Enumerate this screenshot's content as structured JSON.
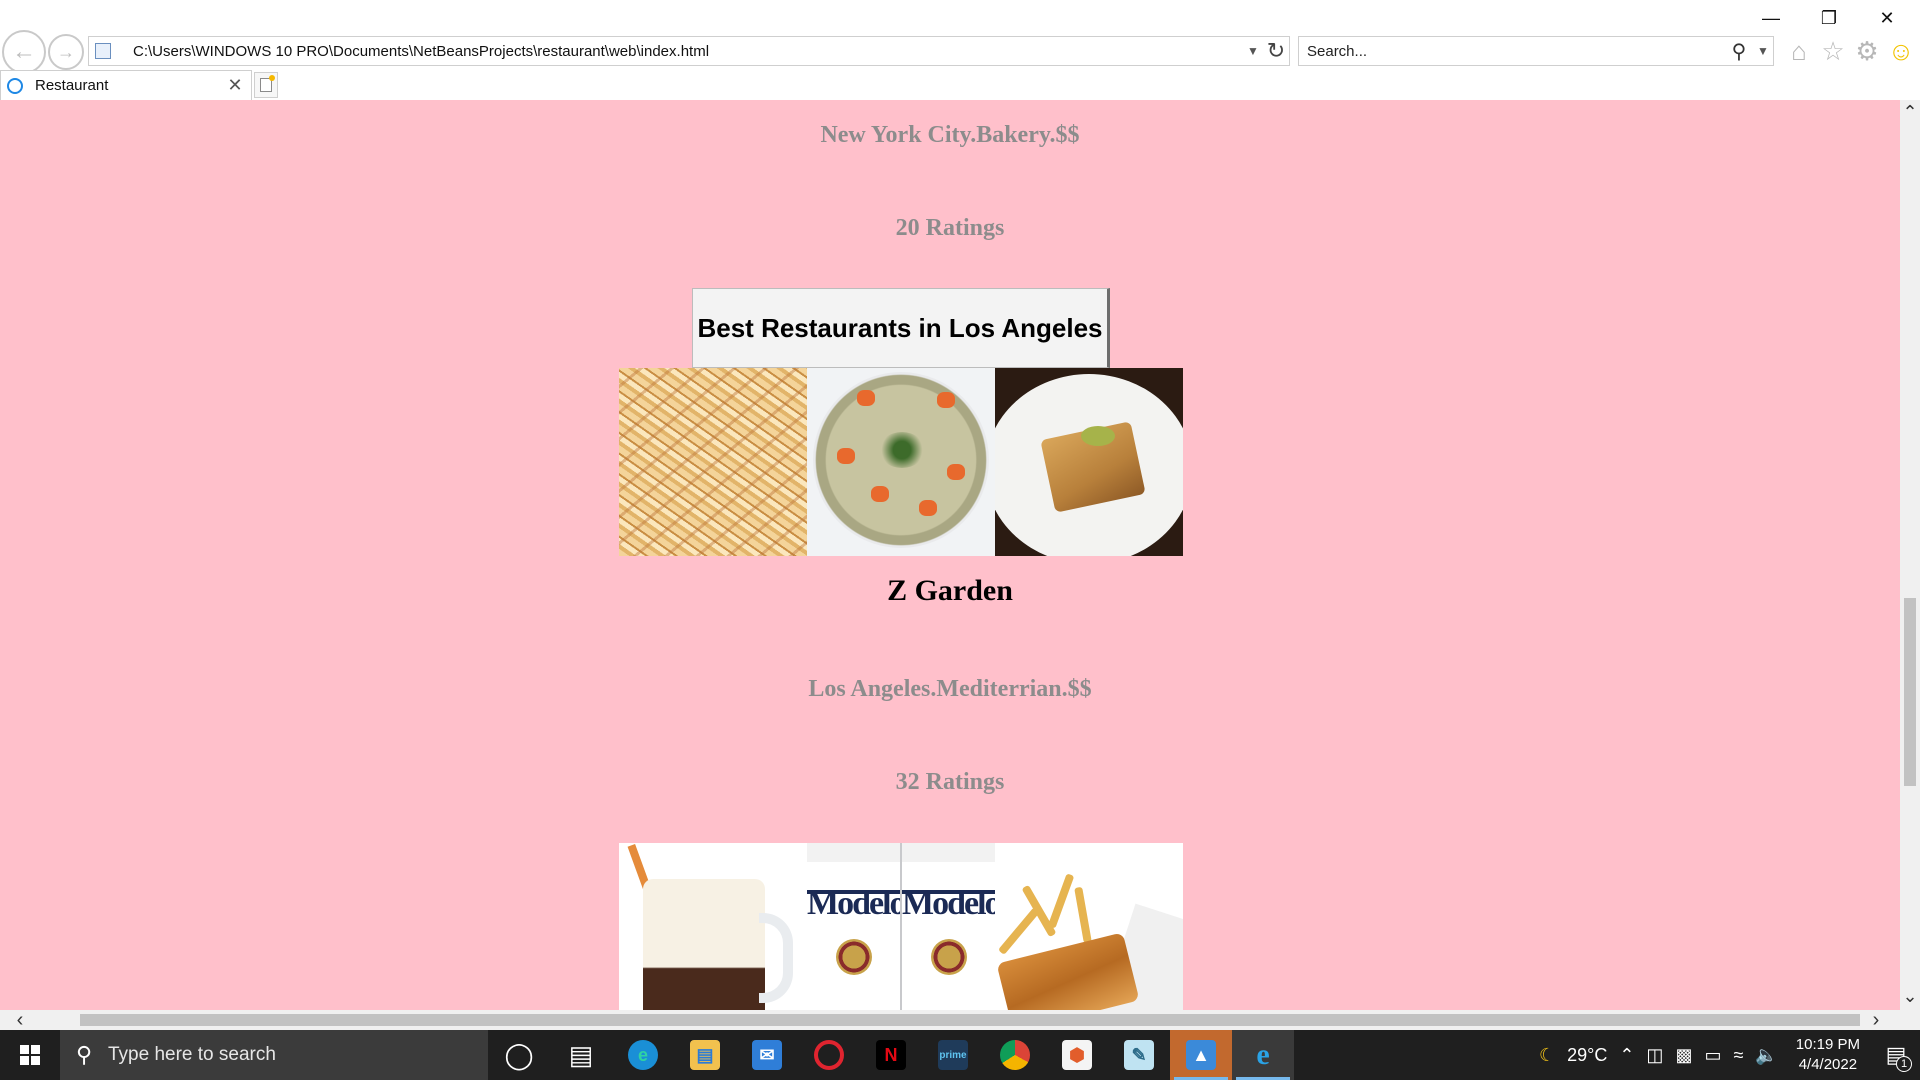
{
  "browser": {
    "address": "C:\\Users\\WINDOWS 10 PRO\\Documents\\NetBeansProjects\\restaurant\\web\\index.html",
    "search_placeholder": "Search...",
    "tab_title": "Restaurant"
  },
  "page": {
    "restaurant1": {
      "info": "New York City.Bakery.$$",
      "ratings": "20 Ratings"
    },
    "section_button": "Best Restaurants in Los Angeles",
    "restaurant2": {
      "name": "Z Garden",
      "info": "Los Angeles.Mediterrian.$$",
      "ratings": "32 Ratings"
    },
    "can_text": "Modelo"
  },
  "taskbar": {
    "search_placeholder": "Type here to search",
    "temperature": "29°C",
    "time": "10:19 PM",
    "date": "4/4/2022",
    "notifications": "1"
  },
  "colors": {
    "page_background": "#ffc0cb",
    "subtitle_text": "#8c8c8c"
  }
}
